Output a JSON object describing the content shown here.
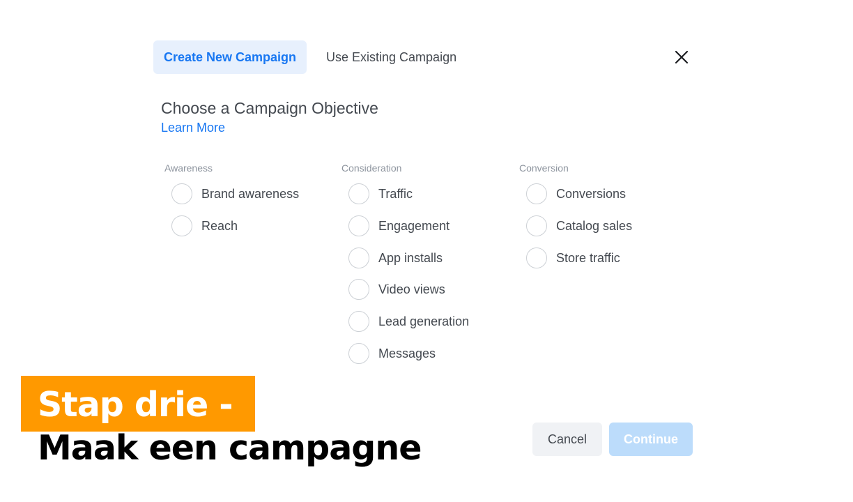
{
  "tabs": {
    "create_new": "Create New Campaign",
    "use_existing": "Use Existing Campaign"
  },
  "heading": {
    "title": "Choose a Campaign Objective",
    "learn_more": "Learn More"
  },
  "columns": [
    {
      "title": "Awareness",
      "options": [
        "Brand awareness",
        "Reach"
      ]
    },
    {
      "title": "Consideration",
      "options": [
        "Traffic",
        "Engagement",
        "App installs",
        "Video views",
        "Lead generation",
        "Messages"
      ]
    },
    {
      "title": "Conversion",
      "options": [
        "Conversions",
        "Catalog sales",
        "Store traffic"
      ]
    }
  ],
  "buttons": {
    "cancel": "Cancel",
    "continue": "Continue"
  },
  "caption": {
    "line1": "Stap drie -",
    "line2": "Maak een campagne"
  },
  "icons": {
    "close": "close-icon"
  },
  "colors": {
    "accent": "#1877f2",
    "tab_active_bg": "#e7f0fd",
    "banner": "#ff9900",
    "continue_disabled": "#bcdcfb"
  }
}
